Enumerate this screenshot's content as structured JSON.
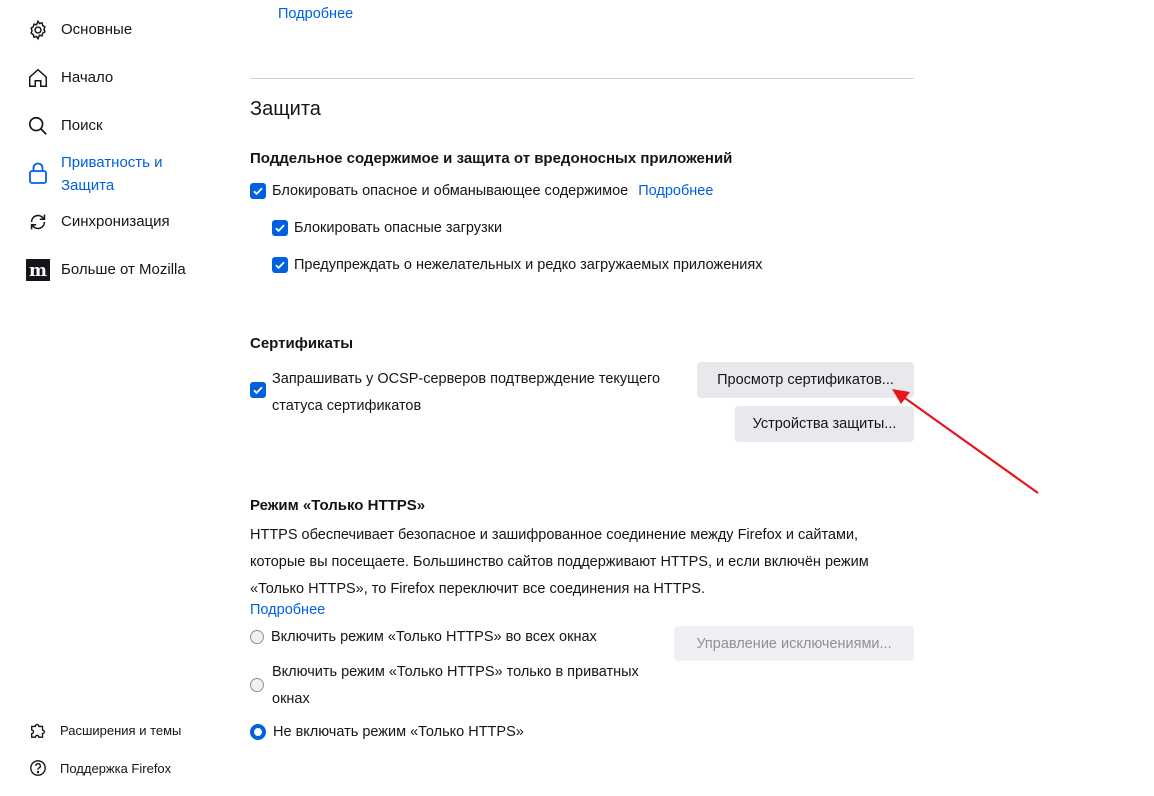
{
  "sidebar": {
    "items": [
      {
        "label": "Основные",
        "icon": "gear-icon"
      },
      {
        "label": "Начало",
        "icon": "home-icon"
      },
      {
        "label": "Поиск",
        "icon": "search-icon"
      },
      {
        "label": "Приватность и Защита",
        "icon": "lock-icon",
        "active": true
      },
      {
        "label": "Синхронизация",
        "icon": "sync-icon"
      },
      {
        "label": "Больше от Mozilla",
        "icon": "mozilla-logo-icon"
      }
    ],
    "footer": [
      {
        "label": "Расширения и темы",
        "icon": "puzzle-icon"
      },
      {
        "label": "Поддержка Firefox",
        "icon": "help-icon"
      }
    ]
  },
  "top_link": "Подробнее",
  "security": {
    "title": "Защита",
    "phishing": {
      "heading": "Поддельное содержимое и защита от вредоносных приложений",
      "block_dangerous": "Блокировать опасное и обманывающее содержимое",
      "learn_more": "Подробнее",
      "block_downloads": "Блокировать опасные загрузки",
      "warn_unwanted": "Предупреждать о нежелательных и редко загружаемых приложениях"
    },
    "certificates": {
      "heading": "Сертификаты",
      "ocsp_line1": "Запрашивать у OCSP-серверов подтверждение текущего",
      "ocsp_line2": "статуса сертификатов",
      "view_button": "Просмотр сертификатов...",
      "devices_button": "Устройства защиты..."
    },
    "https_only": {
      "heading": "Режим «Только HTTPS»",
      "description_line1": "HTTPS обеспечивает безопасное и зашифрованное соединение между Firefox и сайтами,",
      "description_line2": "которые вы посещаете. Большинство сайтов поддерживают HTTPS, и если включён режим",
      "description_line3": "«Только HTTPS», то Firefox переключит все соединения на HTTPS.",
      "learn_more": "Подробнее",
      "option_all": "Включить режим «Только HTTPS» во всех окнах",
      "option_private_line1": "Включить режим «Только HTTPS» только в приватных",
      "option_private_line2": "окнах",
      "option_off": "Не включать режим «Только HTTPS»",
      "selected": "option_off",
      "exceptions_button": "Управление исключениями..."
    }
  },
  "colors": {
    "accent": "#0061e0",
    "annotation_arrow": "#e8151b"
  }
}
